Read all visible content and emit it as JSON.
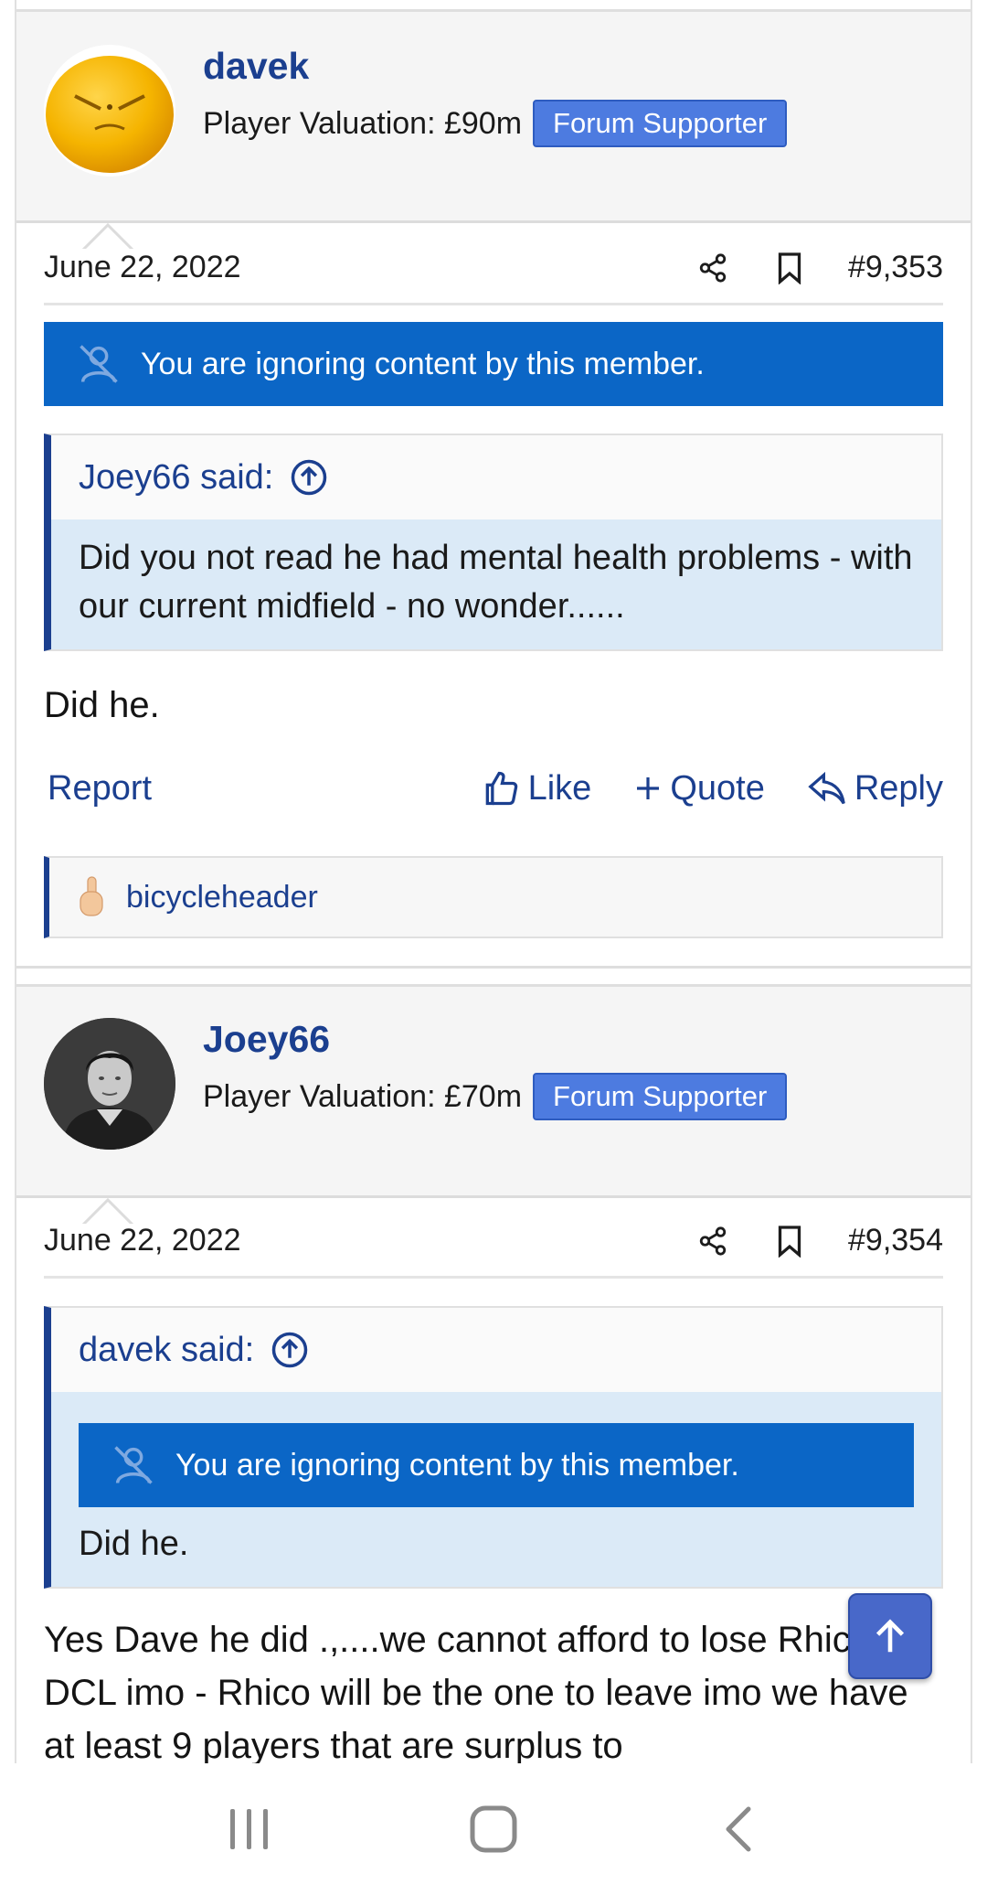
{
  "posts": [
    {
      "username": "davek",
      "valuation": "Player Valuation: £90m",
      "badge": "Forum Supporter",
      "avatar_icon": "angry-orange-avatar",
      "date": "June 22, 2022",
      "number": "#9,353",
      "ignore_notice": "You are ignoring content by this member.",
      "quote": {
        "author": "Joey66 said:",
        "text": "Did you not read he had mental health problems - with our current midfield - no wonder......"
      },
      "message": "Did he.",
      "actions": {
        "report": "Report",
        "like": "Like",
        "quote": "Quote",
        "reply": "Reply"
      },
      "reaction": {
        "emoji_icon": "middle-finger-emoji",
        "user": "bicycleheader"
      }
    },
    {
      "username": "Joey66",
      "valuation": "Player Valuation: £70m",
      "badge": "Forum Supporter",
      "avatar_icon": "player-photo-avatar",
      "date": "June 22, 2022",
      "number": "#9,354",
      "quote": {
        "author": "davek said:",
        "ignore_notice": "You are ignoring content by this member.",
        "text": "Did he."
      },
      "message": "Yes Dave he did .,....we cannot afford to lose Rhico & DCL imo - Rhico will be the one to leave imo we have at least 9 players that are surplus to"
    }
  ],
  "colors": {
    "link": "#1b3f8f",
    "ignore_bar": "#0b66c6",
    "badge": "#4d7be0",
    "quote_body": "#dbeaf7"
  }
}
